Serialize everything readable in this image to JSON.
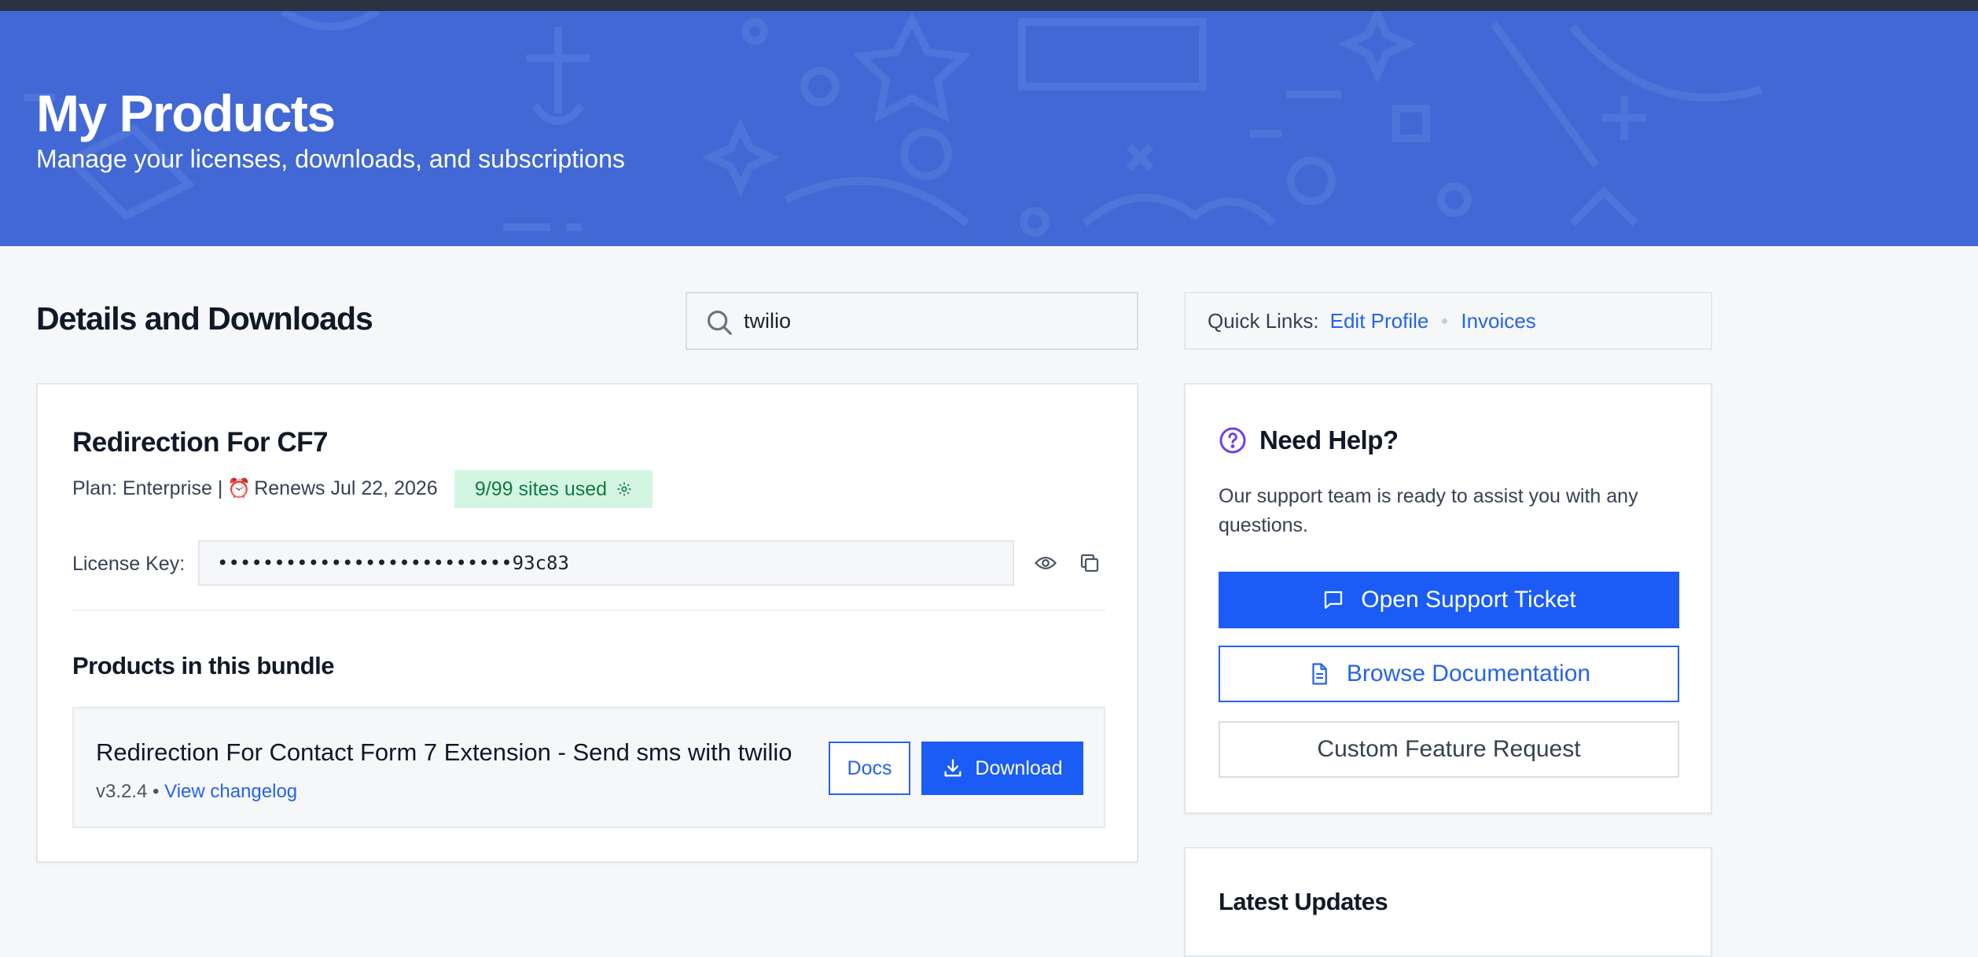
{
  "hero": {
    "title": "My Products",
    "subtitle": "Manage your licenses, downloads, and subscriptions"
  },
  "details": {
    "title": "Details and Downloads"
  },
  "search": {
    "value": "twilio",
    "icon": "search-icon"
  },
  "quick_links": {
    "label": "Quick Links:",
    "edit_profile": "Edit Profile",
    "invoices": "Invoices"
  },
  "product": {
    "name": "Redirection For CF7",
    "plan_prefix": "Plan: Enterprise |",
    "renews": "Renews Jul 22, 2026",
    "sites_used": "9/99 sites used",
    "license_label": "License Key:",
    "license_value": "••••••••••••••••••••••••••93c83",
    "bundle_title": "Products in this bundle",
    "bundle_item": {
      "name": "Redirection For Contact Form 7 Extension - Send sms with twilio",
      "version": "v3.2.4 •",
      "changelog": "View changelog",
      "docs": "Docs",
      "download": "Download"
    }
  },
  "help": {
    "title": "Need Help?",
    "text": "Our support team is ready to assist you with any questions.",
    "open_ticket": "Open Support Ticket",
    "browse_docs": "Browse Documentation",
    "feature_request": "Custom Feature Request"
  },
  "updates": {
    "title": "Latest Updates"
  },
  "colors": {
    "hero_bg": "#4168d4",
    "primary": "#1a5cf5",
    "link": "#2563eb",
    "badge_bg": "#d3f6e2",
    "badge_text": "#137a43"
  }
}
